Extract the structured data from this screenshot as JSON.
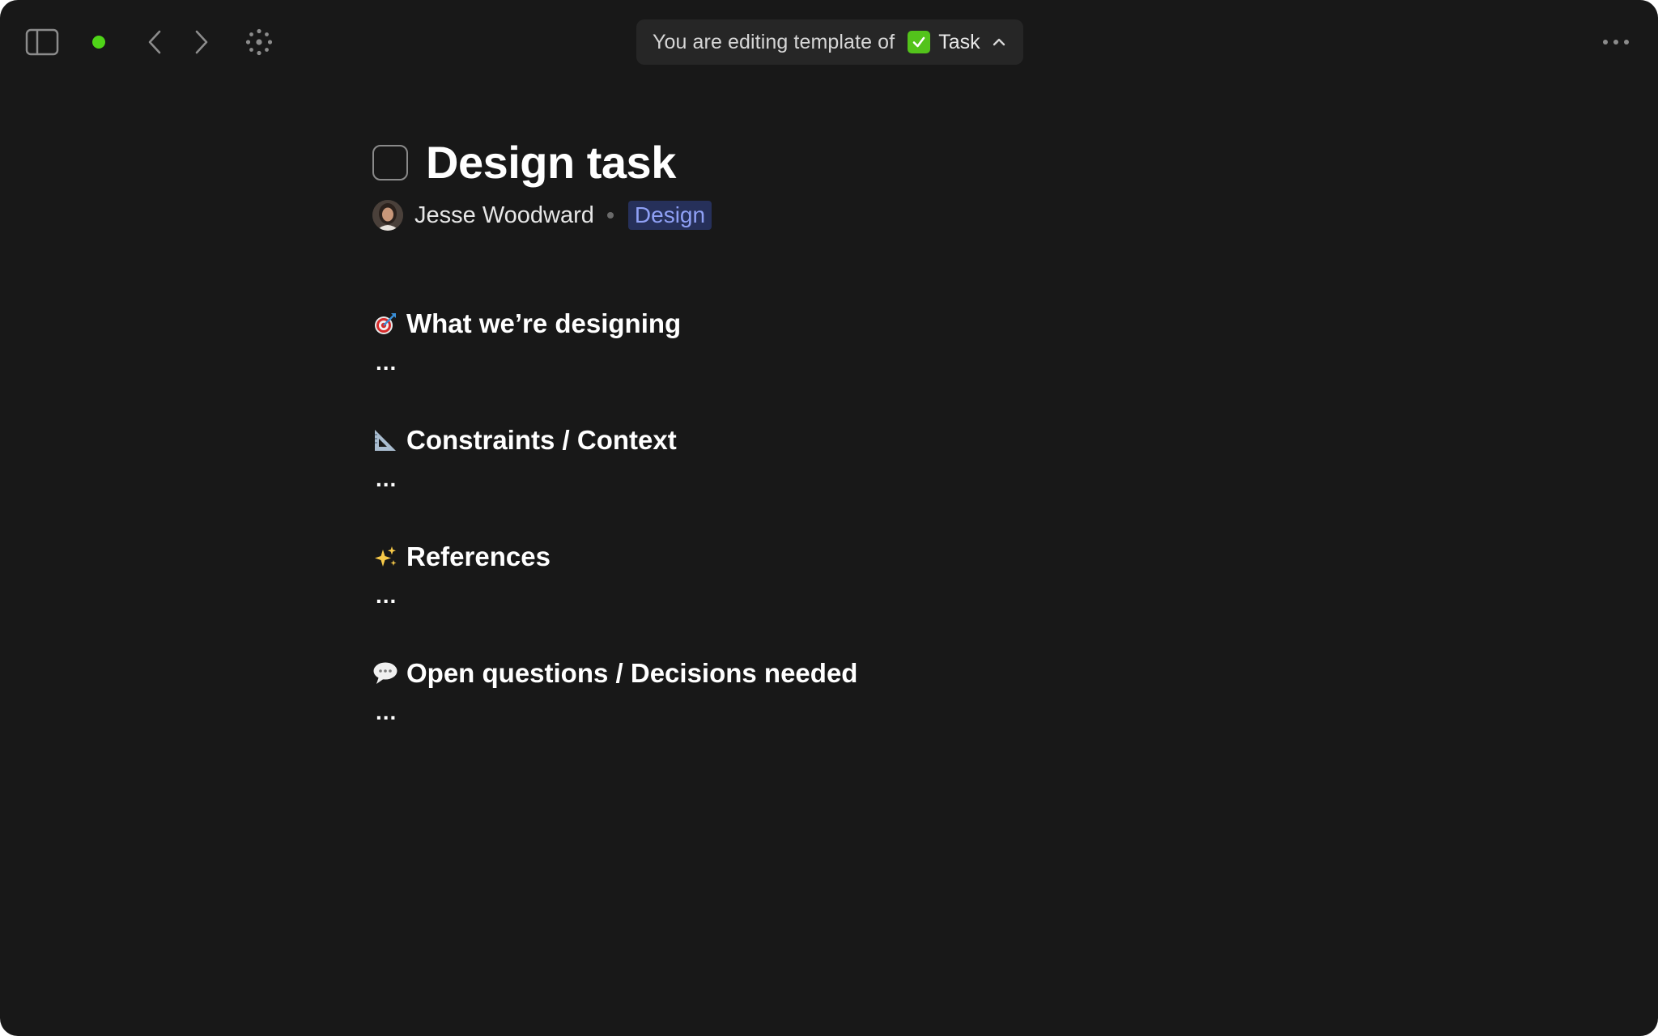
{
  "topbar": {
    "template_prefix": "You are editing template of",
    "type_name": "Task"
  },
  "page": {
    "title": "Design task",
    "author": "Jesse Woodward",
    "tag": "Design"
  },
  "sections": [
    {
      "icon": "target-icon",
      "title": "What we’re designing",
      "body": "..."
    },
    {
      "icon": "triangular-ruler-icon",
      "title": "Constraints / Context",
      "body": "..."
    },
    {
      "icon": "sparkles-icon",
      "title": "References",
      "body": "..."
    },
    {
      "icon": "speech-balloon-icon",
      "title": "Open questions / Decisions needed",
      "body": "..."
    }
  ],
  "colors": {
    "background": "#181818",
    "status_green": "#4fd418",
    "type_icon_green": "#53c31b",
    "tag_bg": "#26305a",
    "tag_text": "#8fa0f5"
  }
}
